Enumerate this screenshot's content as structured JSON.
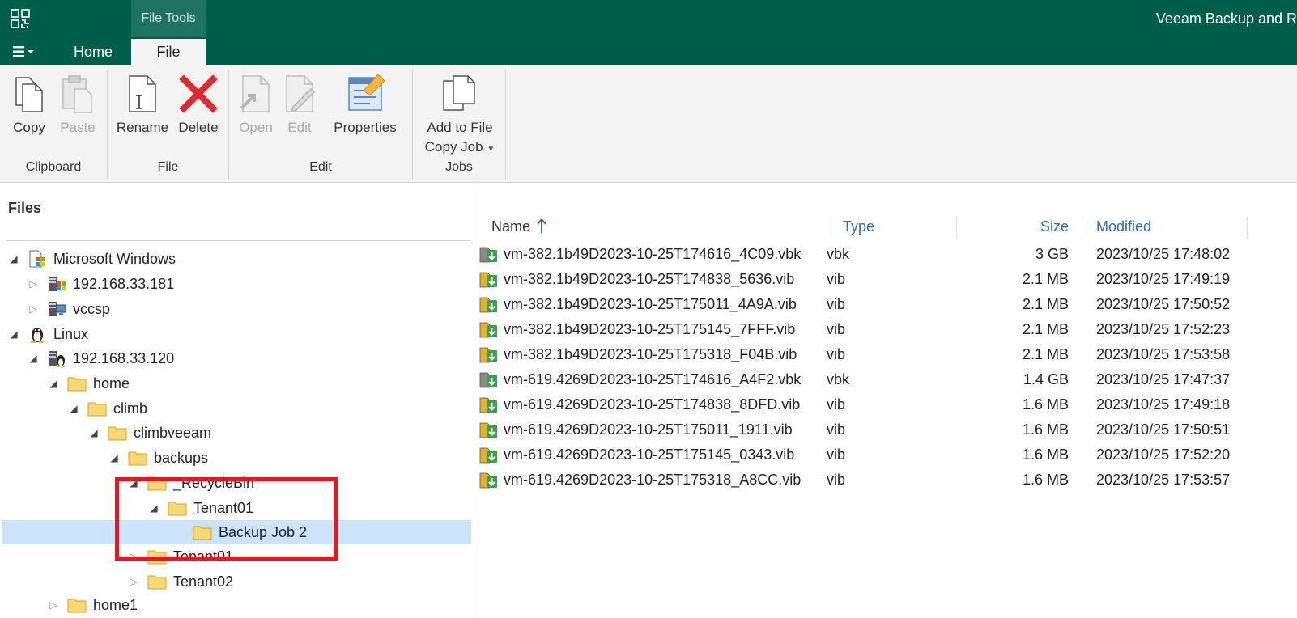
{
  "app": {
    "title": "Veeam Backup and R",
    "context_tab_group": "File Tools",
    "menu_icon": "hamburger-menu-icon",
    "tabs": [
      {
        "label": "Home",
        "active": false
      },
      {
        "label": "File",
        "active": true
      }
    ]
  },
  "ribbon": {
    "groups": {
      "clipboard": {
        "label": "Clipboard",
        "copy": "Copy",
        "paste": "Paste"
      },
      "file": {
        "label": "File",
        "rename": "Rename",
        "delete": "Delete"
      },
      "edit": {
        "label": "Edit",
        "open": "Open",
        "edit": "Edit",
        "properties": "Properties"
      },
      "jobs": {
        "label": "Jobs",
        "add_to_file_copy_job_line1": "Add to File",
        "add_to_file_copy_job_line2": "Copy Job"
      }
    }
  },
  "files_pane": {
    "title": "Files",
    "tree": [
      {
        "label": "Microsoft Windows",
        "icon": "windows-servers-icon"
      },
      {
        "label": "192.168.33.181",
        "icon": "windows-server-icon"
      },
      {
        "label": "vccsp",
        "icon": "server-icon"
      },
      {
        "label": "Linux",
        "icon": "linux-penguin-icon"
      },
      {
        "label": "192.168.33.120",
        "icon": "linux-server-icon"
      },
      {
        "label": "home",
        "icon": "folder-icon"
      },
      {
        "label": "climb",
        "icon": "folder-icon"
      },
      {
        "label": "climbveeam",
        "icon": "folder-icon"
      },
      {
        "label": "backups",
        "icon": "folder-icon"
      },
      {
        "label": "_RecycleBin",
        "icon": "folder-icon"
      },
      {
        "label": "Tenant01",
        "icon": "folder-icon"
      },
      {
        "label": "Backup Job 2",
        "icon": "folder-icon",
        "selected": true
      },
      {
        "label": "Tenant01",
        "icon": "folder-icon"
      },
      {
        "label": "Tenant02",
        "icon": "folder-icon"
      },
      {
        "label": "home1",
        "icon": "folder-icon"
      }
    ]
  },
  "file_list": {
    "columns": {
      "name": "Name",
      "type": "Type",
      "size": "Size",
      "modified": "Modified"
    },
    "sort": {
      "column": "Name",
      "direction": "ascending",
      "icon": "sort-up-arrow-icon"
    },
    "rows": [
      {
        "name": "vm-382.1b49D2023-10-25T174616_4C09.vbk",
        "type": "vbk",
        "size": "3 GB",
        "modified": "2023/10/25 17:48:02",
        "icon": "full-backup-file-icon"
      },
      {
        "name": "vm-382.1b49D2023-10-25T174838_5636.vib",
        "type": "vib",
        "size": "2.1 MB",
        "modified": "2023/10/25 17:49:19",
        "icon": "incremental-backup-file-icon"
      },
      {
        "name": "vm-382.1b49D2023-10-25T175011_4A9A.vib",
        "type": "vib",
        "size": "2.1 MB",
        "modified": "2023/10/25 17:50:52",
        "icon": "incremental-backup-file-icon"
      },
      {
        "name": "vm-382.1b49D2023-10-25T175145_7FFF.vib",
        "type": "vib",
        "size": "2.1 MB",
        "modified": "2023/10/25 17:52:23",
        "icon": "incremental-backup-file-icon"
      },
      {
        "name": "vm-382.1b49D2023-10-25T175318_F04B.vib",
        "type": "vib",
        "size": "2.1 MB",
        "modified": "2023/10/25 17:53:58",
        "icon": "incremental-backup-file-icon"
      },
      {
        "name": "vm-619.4269D2023-10-25T174616_A4F2.vbk",
        "type": "vbk",
        "size": "1.4 GB",
        "modified": "2023/10/25 17:47:37",
        "icon": "full-backup-file-icon"
      },
      {
        "name": "vm-619.4269D2023-10-25T174838_8DFD.vib",
        "type": "vib",
        "size": "1.6 MB",
        "modified": "2023/10/25 17:49:18",
        "icon": "incremental-backup-file-icon"
      },
      {
        "name": "vm-619.4269D2023-10-25T175011_1911.vib",
        "type": "vib",
        "size": "1.6 MB",
        "modified": "2023/10/25 17:50:51",
        "icon": "incremental-backup-file-icon"
      },
      {
        "name": "vm-619.4269D2023-10-25T175145_0343.vib",
        "type": "vib",
        "size": "1.6 MB",
        "modified": "2023/10/25 17:52:20",
        "icon": "incremental-backup-file-icon"
      },
      {
        "name": "vm-619.4269D2023-10-25T175318_A8CC.vib",
        "type": "vib",
        "size": "1.6 MB",
        "modified": "2023/10/25 17:53:57",
        "icon": "incremental-backup-file-icon"
      }
    ]
  },
  "colors": {
    "title_bar": "#005f4b",
    "selection": "#cce4fb",
    "highlight_box": "#e31a22",
    "column_header_text": "#2f6fb0"
  }
}
